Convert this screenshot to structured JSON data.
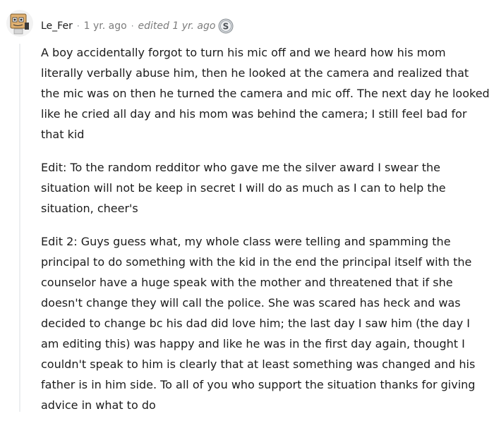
{
  "comment": {
    "username": "Le_Fer",
    "separator": "·",
    "time_ago": "1 yr. ago",
    "edited": "edited 1 yr. ago",
    "award_icon": "silver-award-icon",
    "paragraphs": [
      "A boy accidentally forgot to turn his mic off and we heard how his mom literally verbally abuse him, then he looked at the camera and realized that the mic was on then he turned the camera and mic off. The next day he looked like he cried all day and his mom was behind the camera; I still feel bad for that kid",
      "Edit: To the random redditor who gave me the silver award I swear the situation will not be keep in secret I will do as much as I can to help the situation, cheer's",
      "Edit 2: Guys guess what, my whole class were telling and spamming the principal to do something with the kid in the end the principal itself with the counselor have a huge speak with the mother and threatened that if she doesn't change they will call the police. She was scared has heck and was decided to change bc his dad did love him; the last day I saw him (the day I am editing this) was happy and like he was in the first day again, thought I couldn't speak to him is clearly that at least something was changed and his father is in him side. To all of you who support the situation thanks for giving advice in what to do"
    ]
  }
}
